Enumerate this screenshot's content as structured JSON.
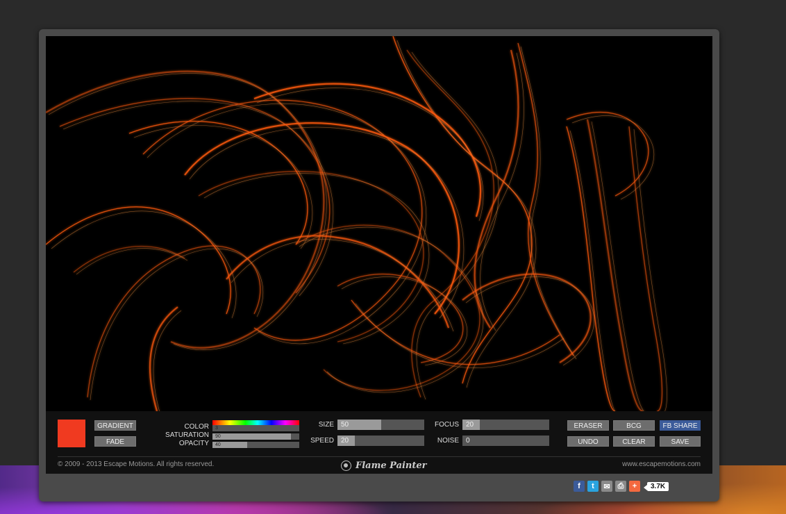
{
  "app": {
    "brand_name": "Flame Painter"
  },
  "color": {
    "current": "#f03a20",
    "accent_fb": "#3b5b9a",
    "flame": "#ff5a10"
  },
  "left_buttons": {
    "gradient": "GRADIENT",
    "fade": "FADE"
  },
  "color_panel": {
    "color_label": "COLOR",
    "color_value": "3",
    "saturation_label": "SATURATION",
    "saturation_value": "90",
    "saturation_fraction": 0.9,
    "opacity_label": "OPACITY",
    "opacity_value": "40",
    "opacity_fraction": 0.4
  },
  "brush": {
    "size_label": "SIZE",
    "size_value": "50",
    "size_fraction": 0.5,
    "speed_label": "SPEED",
    "speed_value": "20",
    "speed_fraction": 0.2,
    "focus_label": "FOCUS",
    "focus_value": "20",
    "focus_fraction": 0.2,
    "noise_label": "NOISE",
    "noise_value": "0",
    "noise_fraction": 0
  },
  "actions": {
    "eraser": "ERASER",
    "bcg": "BCG",
    "fb_share": "FB SHARE",
    "undo": "UNDO",
    "clear": "CLEAR",
    "save": "SAVE"
  },
  "footer": {
    "copyright": "© 2009 - 2013 Escape Motions. All rights reserved.",
    "website": "www.escapemotions.com"
  },
  "share": {
    "icons": [
      "facebook-icon",
      "twitter-icon",
      "email-icon",
      "print-icon",
      "plus-icon"
    ],
    "count": "3.7K"
  }
}
